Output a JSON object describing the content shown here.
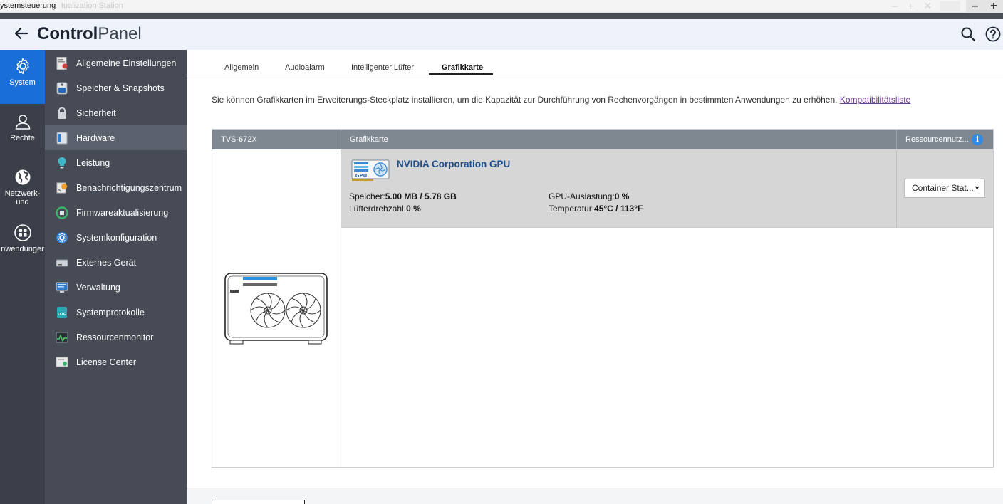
{
  "window": {
    "title": "ystemsteuerung",
    "ghost_title": "tualization Station"
  },
  "header": {
    "brand_bold": "Control",
    "brand_light": "Panel"
  },
  "rail": [
    {
      "label": "System",
      "icon": "gear-icon",
      "active": true
    },
    {
      "label": "Rechte",
      "icon": "user-icon",
      "active": false
    },
    {
      "label_line1": "Netzwerk-",
      "label_line2": "und",
      "icon": "globe-icon",
      "active": false
    },
    {
      "label": "nwendunger",
      "icon": "apps-grid-icon",
      "active": false
    }
  ],
  "nav": {
    "items": [
      {
        "label": "Allgemeine Einstellungen",
        "icon": "settings-doc-icon"
      },
      {
        "label": "Speicher & Snapshots",
        "icon": "storage-icon"
      },
      {
        "label": "Sicherheit",
        "icon": "lock-icon"
      },
      {
        "label": "Hardware",
        "icon": "hardware-icon",
        "active": true
      },
      {
        "label": "Leistung",
        "icon": "bulb-icon"
      },
      {
        "label": "Benachrichtigungszentrum",
        "icon": "notification-icon"
      },
      {
        "label": "Firmwareaktualisierung",
        "icon": "firmware-icon"
      },
      {
        "label": "Systemkonfiguration",
        "icon": "config-gear-icon"
      },
      {
        "label": "Externes Gerät",
        "icon": "external-device-icon"
      },
      {
        "label": "Verwaltung",
        "icon": "monitor-icon"
      },
      {
        "label": "Systemprotokolle",
        "icon": "log-icon"
      },
      {
        "label": "Ressourcenmonitor",
        "icon": "resource-monitor-icon"
      },
      {
        "label": "License Center",
        "icon": "license-icon"
      }
    ]
  },
  "tabs": [
    {
      "label": "Allgemein"
    },
    {
      "label": "Audioalarm"
    },
    {
      "label": "Intelligenter Lüfter"
    },
    {
      "label": "Grafikkarte",
      "active": true
    }
  ],
  "description": {
    "text": "Sie können Grafikkarten im Erweiterungs-Steckplatz installieren, um die Kapazität zur Durchführung von Rechenvorgängen in bestimmten Anwendungen zu erhöhen. ",
    "link": "Kompatibilitätsliste"
  },
  "grid": {
    "headers": {
      "device": "TVS-672X",
      "gpu": "Grafikkarte",
      "resource": "Ressourcennutz..."
    },
    "gpu": {
      "name": "NVIDIA Corporation GPU",
      "icon_text": "GPU",
      "memory_label": "Speicher:",
      "memory_value": "5.00 MB / 5.78 GB",
      "fan_label": "Lüfterdrehzahl:",
      "fan_value": "0 %",
      "util_label": "GPU-Auslastung:",
      "util_value": "0 %",
      "temp_label": "Temperatur:",
      "temp_value": "45°C / 113°F"
    },
    "resource_dropdown": "Container Stat..."
  },
  "colors": {
    "accent_blue": "#1a6ed8",
    "rail_bg": "#3a3f49",
    "nav_bg": "#464b55",
    "nav_active": "#5c626d",
    "grid_header": "#7f8791",
    "gpu_name": "#1f4f8a",
    "link": "#6b3c86"
  }
}
